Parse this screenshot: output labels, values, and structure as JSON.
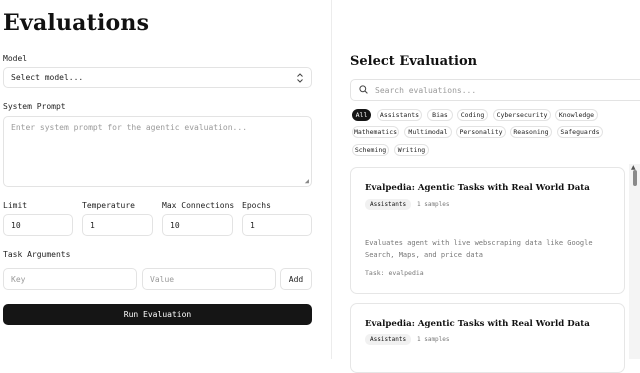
{
  "page": {
    "title": "Evaluations"
  },
  "form": {
    "model_label": "Model",
    "model_value": "Select model...",
    "system_prompt_label": "System Prompt",
    "system_prompt_placeholder": "Enter system prompt for the agentic evaluation...",
    "params": [
      {
        "label": "Limit",
        "value": "10"
      },
      {
        "label": "Temperature",
        "value": "1"
      },
      {
        "label": "Max Connections",
        "value": "10"
      },
      {
        "label": "Epochs",
        "value": "1"
      }
    ],
    "task_args_label": "Task Arguments",
    "key_placeholder": "Key",
    "value_placeholder": "Value",
    "add_label": "Add",
    "run_label": "Run Evaluation"
  },
  "select": {
    "title": "Select Evaluation",
    "search_placeholder": "Search evaluations...",
    "tags": [
      "All",
      "Assistants",
      "Bias",
      "Coding",
      "Cybersecurity",
      "Knowledge",
      "Mathematics",
      "Multimodal",
      "Personality",
      "Reasoning",
      "Safeguards",
      "Scheming",
      "Writing"
    ],
    "active_tag": "All",
    "cards": [
      {
        "title": "Evalpedia: Agentic Tasks with Real World Data",
        "badge": "Assistants",
        "samples": "1 samples",
        "description": "Evaluates agent with live webscraping data like Google Search, Maps, and price data",
        "task": "Task: evalpedia"
      },
      {
        "title": "Evalpedia: Agentic Tasks with Real World Data",
        "badge": "Assistants",
        "samples": "1 samples"
      }
    ]
  },
  "icons": {
    "search": "search-icon",
    "chevron": "chevron-updown-icon"
  }
}
